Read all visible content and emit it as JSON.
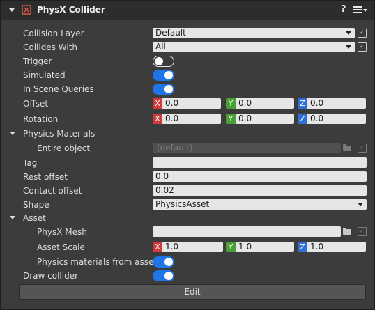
{
  "header": {
    "title": "PhysX Collider",
    "help": "?",
    "icon": "physx-collider-icon"
  },
  "fields": {
    "collision_layer": {
      "label": "Collision Layer",
      "value": "Default"
    },
    "collides_with": {
      "label": "Collides With",
      "value": "All"
    },
    "trigger": {
      "label": "Trigger",
      "on": false
    },
    "simulated": {
      "label": "Simulated",
      "on": true
    },
    "in_scene_queries": {
      "label": "In Scene Queries",
      "on": true
    },
    "offset": {
      "label": "Offset",
      "x": "0.0",
      "y": "0.0",
      "z": "0.0"
    },
    "rotation": {
      "label": "Rotation",
      "x": "0.0",
      "y": "0.0",
      "z": "0.0"
    },
    "physics_materials": {
      "label": "Physics Materials"
    },
    "entire_object": {
      "label": "Entire object",
      "value": "(default)"
    },
    "tag": {
      "label": "Tag",
      "value": ""
    },
    "rest_offset": {
      "label": "Rest offset",
      "value": "0.0"
    },
    "contact_offset": {
      "label": "Contact offset",
      "value": "0.02"
    },
    "shape": {
      "label": "Shape",
      "value": "PhysicsAsset"
    },
    "asset": {
      "label": "Asset"
    },
    "physx_mesh": {
      "label": "PhysX Mesh",
      "value": ""
    },
    "asset_scale": {
      "label": "Asset Scale",
      "x": "1.0",
      "y": "1.0",
      "z": "1.0"
    },
    "physics_materials_from_asset": {
      "label": "Physics materials from asset",
      "on": true
    },
    "draw_collider": {
      "label": "Draw collider",
      "on": true
    }
  },
  "axis_tags": {
    "x": "X",
    "y": "Y",
    "z": "Z"
  },
  "edit_button": {
    "label": "Edit"
  },
  "colors": {
    "toggle_on": "#1f74e8",
    "axis_x": "#cf3a3a",
    "axis_y": "#4a9e35",
    "axis_z": "#2f6fd6"
  }
}
